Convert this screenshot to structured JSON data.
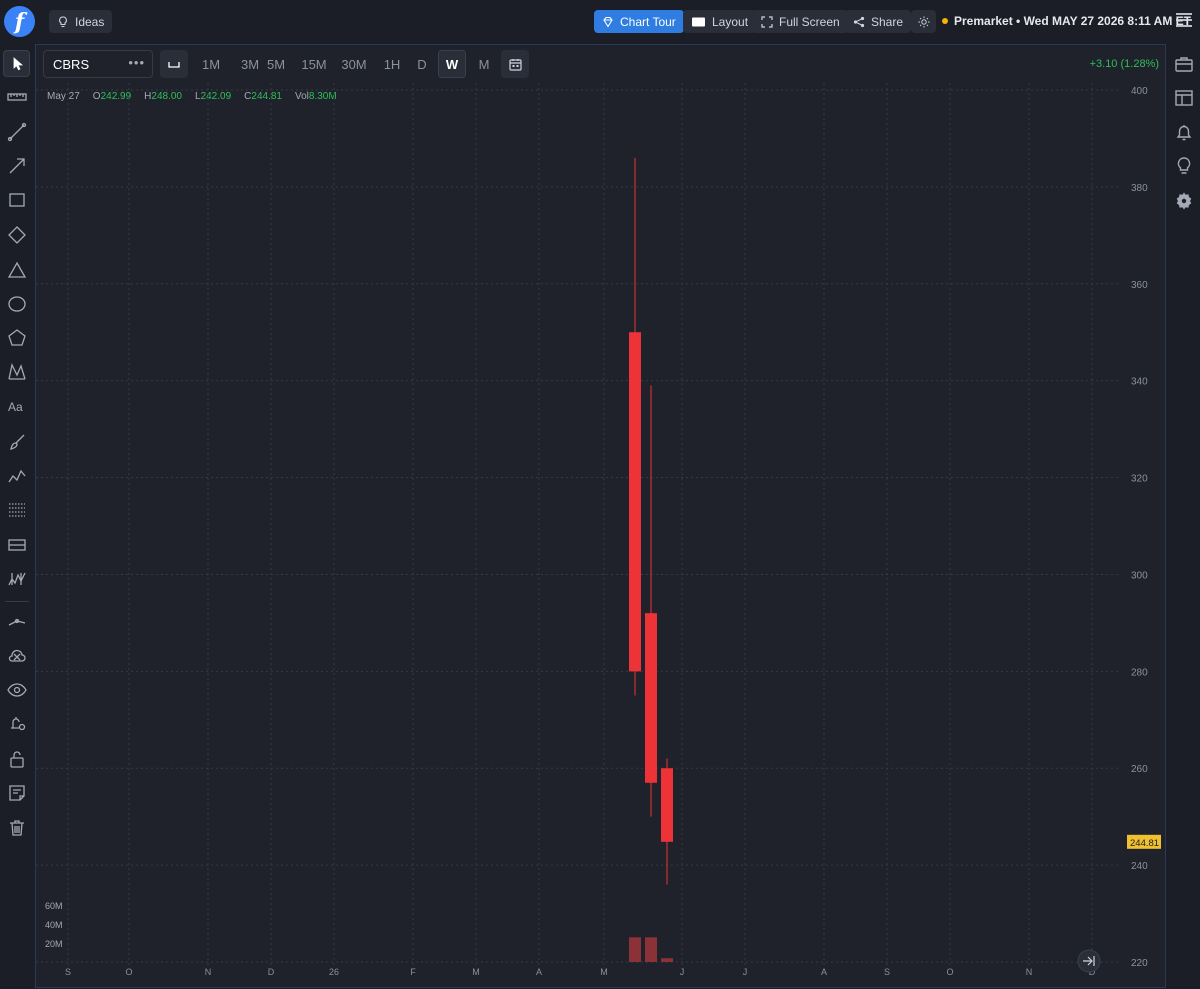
{
  "header": {
    "ideas_label": "Ideas",
    "chart_tour_label": "Chart Tour",
    "layout_label": "Layout",
    "fullscreen_label": "Full Screen",
    "share_label": "Share",
    "session_text": "Premarket • Wed MAY 27 2026 8:11 AM ET"
  },
  "toolbar": {
    "symbol": "CBRS",
    "more": "•••",
    "intervals": [
      "1M",
      "3M",
      "5M",
      "15M",
      "30M",
      "1H",
      "D",
      "W",
      "M"
    ],
    "active_interval": "W",
    "change_text": "+3.10 (1.28%)"
  },
  "legend": {
    "date": "May 27",
    "open_label": "O",
    "open": "242.99",
    "high_label": "H",
    "high": "248.00",
    "low_label": "L",
    "low": "242.09",
    "close_label": "C",
    "close": "244.81",
    "vol_label": "Vol",
    "vol": "8.30M"
  },
  "colors": {
    "down": "#ee3338",
    "up": "#2fbf5a",
    "price_tag": "#f0c030",
    "accent": "#2f7de1"
  },
  "chart_data": {
    "type": "candlestick",
    "y_ticks": [
      "400",
      "380",
      "360",
      "340",
      "320",
      "300",
      "280",
      "260",
      "240",
      "220"
    ],
    "x_ticks": [
      "S",
      "O",
      "N",
      "D",
      "26",
      "F",
      "M",
      "A",
      "M",
      "J",
      "J",
      "A",
      "S",
      "O",
      "N",
      "D"
    ],
    "volume_ticks": [
      "60M",
      "40M",
      "20M"
    ],
    "ylim": [
      220,
      400
    ],
    "volume_lim": [
      0,
      60
    ],
    "last_price_label": "244.81",
    "candles": [
      {
        "open": 350,
        "high": 386,
        "low": 275,
        "close": 280,
        "volume": 26
      },
      {
        "open": 292,
        "high": 339,
        "low": 250,
        "close": 257,
        "volume": 26
      },
      {
        "open": 260,
        "high": 262,
        "low": 236,
        "close": 244.81,
        "volume": 4
      }
    ]
  }
}
